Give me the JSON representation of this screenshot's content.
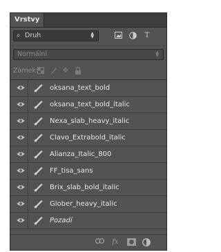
{
  "panel": {
    "tab_label": "Vrstvy"
  },
  "filter": {
    "kind_value": "Druh",
    "icons": [
      "image-filter-icon",
      "adjustment-filter-icon",
      "type-filter-icon"
    ],
    "type_glyph": "T"
  },
  "blend": {
    "mode_value": "Normální"
  },
  "lock": {
    "label": "Zámek:"
  },
  "layers": [
    {
      "name": "oksana_text_bold",
      "italic": false
    },
    {
      "name": "oksana_text_bold_italic",
      "italic": false
    },
    {
      "name": "Nexa_slab_heavy_italic",
      "italic": false
    },
    {
      "name": "Clavo_Extrabold_italic",
      "italic": false
    },
    {
      "name": "Alianza_Italic_800",
      "italic": false
    },
    {
      "name": "FF_tisa_sans",
      "italic": false
    },
    {
      "name": "Brix_slab_bold_italic",
      "italic": false
    },
    {
      "name": "Glober_heavy_italic",
      "italic": false
    },
    {
      "name": "Pozadí",
      "italic": true
    }
  ],
  "bottom_icons": [
    "link-icon",
    "fx-icon",
    "mask-icon",
    "adjustment-icon"
  ],
  "bottom_fx": "fx",
  "colors": {
    "panel": "#535353",
    "text": "#e6e6e6",
    "dim": "#8c8c8c"
  }
}
